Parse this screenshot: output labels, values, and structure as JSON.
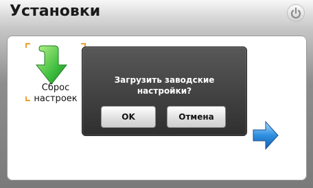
{
  "header": {
    "title": "Установки",
    "power_icon": "power-icon"
  },
  "content": {
    "items": [
      {
        "label_line1": "Сброс",
        "label_line2": "настроек",
        "icon": "green-down-arrow-icon"
      }
    ],
    "next_icon": "blue-right-arrow-icon"
  },
  "dialog": {
    "line1": "Загрузить заводские",
    "line2": "настройки?",
    "ok_label": "OK",
    "cancel_label": "Отмена"
  },
  "colors": {
    "dialog_bg": "#3a3a3a",
    "accent_green": "#3fbf3f",
    "accent_blue": "#2f8fe0",
    "corner_orange": "#f0a02a"
  }
}
